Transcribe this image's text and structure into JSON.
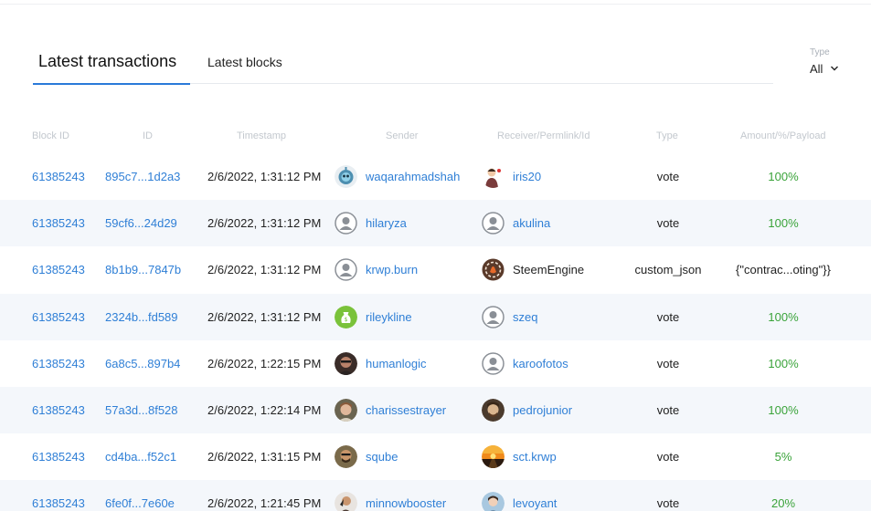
{
  "tabs": [
    {
      "label": "Latest transactions",
      "active": true
    },
    {
      "label": "Latest blocks",
      "active": false
    }
  ],
  "type_filter": {
    "label": "Type",
    "value": "All"
  },
  "columns": [
    "Block ID",
    "ID",
    "Timestamp",
    "Sender",
    "Receiver/Permlink/Id",
    "Type",
    "Amount/%/Payload"
  ],
  "colors": {
    "link": "#2f7fd6",
    "accent": "#2a7ad9",
    "green": "#3aa33a",
    "row_alt": "#f4f7fb"
  },
  "rows": [
    {
      "block_id": "61385243",
      "id": "895c7...1d2a3",
      "timestamp": "2/6/2022, 1:31:12 PM",
      "sender": "waqarahmadshah",
      "sender_avatar": "robot-avatar",
      "receiver": "iris20",
      "receiver_avatar": "person-avatar",
      "type": "vote",
      "amount": "100%"
    },
    {
      "block_id": "61385243",
      "id": "59cf6...24d29",
      "timestamp": "2/6/2022, 1:31:12 PM",
      "sender": "hilaryza",
      "sender_avatar": "default-avatar",
      "receiver": "akulina",
      "receiver_avatar": "default-avatar",
      "type": "vote",
      "amount": "100%"
    },
    {
      "block_id": "61385243",
      "id": "8b1b9...7847b",
      "timestamp": "2/6/2022, 1:31:12 PM",
      "sender": "krwp.burn",
      "sender_avatar": "default-avatar",
      "receiver": "SteemEngine",
      "receiver_avatar": "steemengine-avatar",
      "type": "custom_json",
      "amount": "{\"contrac...oting\"}}"
    },
    {
      "block_id": "61385243",
      "id": "2324b...fd589",
      "timestamp": "2/6/2022, 1:31:12 PM",
      "sender": "rileykline",
      "sender_avatar": "money-bag-avatar",
      "receiver": "szeq",
      "receiver_avatar": "default-avatar",
      "type": "vote",
      "amount": "100%"
    },
    {
      "block_id": "61385243",
      "id": "6a8c5...897b4",
      "timestamp": "2/6/2022, 1:22:15 PM",
      "sender": "humanlogic",
      "sender_avatar": "photo-avatar",
      "receiver": "karoofotos",
      "receiver_avatar": "default-avatar",
      "type": "vote",
      "amount": "100%"
    },
    {
      "block_id": "61385243",
      "id": "57a3d...8f528",
      "timestamp": "2/6/2022, 1:22:14 PM",
      "sender": "charissestrayer",
      "sender_avatar": "photo-avatar",
      "receiver": "pedrojunior",
      "receiver_avatar": "photo-avatar",
      "type": "vote",
      "amount": "100%"
    },
    {
      "block_id": "61385243",
      "id": "cd4ba...f52c1",
      "timestamp": "2/6/2022, 1:31:15 PM",
      "sender": "sqube",
      "sender_avatar": "photo-avatar",
      "receiver": "sct.krwp",
      "receiver_avatar": "sunset-avatar",
      "type": "vote",
      "amount": "5%"
    },
    {
      "block_id": "61385243",
      "id": "6fe0f...7e60e",
      "timestamp": "2/6/2022, 1:21:45 PM",
      "sender": "minnowbooster",
      "sender_avatar": "photo-avatar",
      "receiver": "levoyant",
      "receiver_avatar": "photo-avatar",
      "type": "vote",
      "amount": "20%"
    }
  ]
}
